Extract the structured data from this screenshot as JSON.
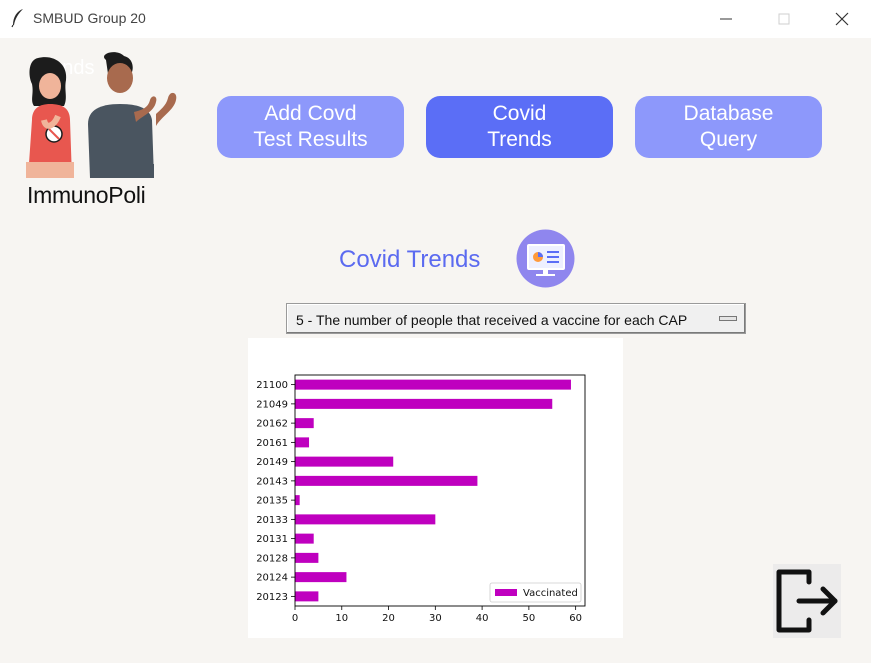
{
  "window": {
    "title": "SMBUD Group 20"
  },
  "logo": {
    "overlay_text": "Trends",
    "brand": "ImmunoPoli"
  },
  "nav": [
    {
      "label": "Add Covd\nTest Results",
      "active": false
    },
    {
      "label": "Covid\nTrends",
      "active": true
    },
    {
      "label": "Database\nQuery",
      "active": false
    }
  ],
  "section": {
    "title": "Covid Trends",
    "icon": "presentation-chart-icon"
  },
  "query_select": {
    "value": "5 - The number of people that received a vaccine for each CAP"
  },
  "colors": {
    "accent": "#5b6ef6",
    "button": "#8d98fb",
    "bar": "#bf00bf"
  },
  "chart_data": {
    "type": "bar",
    "orientation": "horizontal",
    "categories": [
      "21100",
      "21049",
      "20162",
      "20161",
      "20149",
      "20143",
      "20135",
      "20133",
      "20131",
      "20128",
      "20124",
      "20123"
    ],
    "series": [
      {
        "name": "Vaccinated",
        "values": [
          59,
          55,
          4,
          3,
          21,
          39,
          1,
          30,
          4,
          5,
          11,
          5
        ]
      }
    ],
    "xlim": [
      0,
      62
    ],
    "x_ticks": [
      0,
      10,
      20,
      30,
      40,
      50,
      60
    ],
    "legend_position": "lower-right",
    "grid": false
  },
  "logout": {
    "icon": "logout-icon"
  }
}
